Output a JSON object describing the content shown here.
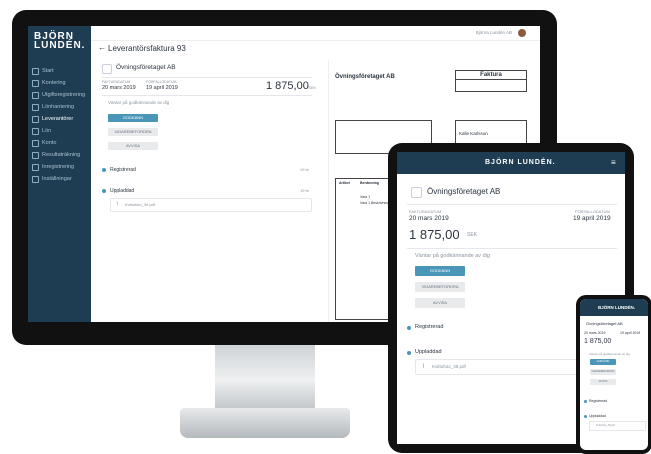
{
  "brand": {
    "line1": "BJÖRN",
    "line2": "LUNDÉN."
  },
  "sidebar": {
    "items": [
      "Start",
      "Kontering",
      "Utgiftsregistrering",
      "Lönhantering",
      "Leverantörer",
      "Lön",
      "Konto",
      "Resultaträkning",
      "Inregistrering",
      "Inställningar"
    ]
  },
  "topbar": {
    "user": "Björna Lundén AB"
  },
  "page": {
    "title": "Leverantörsfaktura 93"
  },
  "supplier": {
    "name": "Övningsföretaget AB"
  },
  "dates": {
    "invoice_label": "FAKTURADATUM",
    "invoice_date": "20 mars 2019",
    "due_label": "FÖRFALLODATUM",
    "due_date": "19 april 2019"
  },
  "amount": {
    "value": "1 875,00",
    "currency": "SEK"
  },
  "status": {
    "text": "Väntar på godkännande av dig"
  },
  "buttons": {
    "approve": "GODKÄNN",
    "forward": "VIDAREBEFORDRA",
    "reject": "AVVISA"
  },
  "timeline": {
    "registered": "Registrerad",
    "registered_date": "19 fe",
    "uploaded": "Uppladdad",
    "uploaded_date": "19 fe",
    "attachment": "Kvittofoto_39.pdf"
  },
  "invoice_doc": {
    "company": "Övningsföretaget AB",
    "header": "Faktura",
    "recipient": "Kalle Karlsson",
    "col_article": "Artikel",
    "col_desc": "Benämning",
    "row1": "Vara 1",
    "row2": "Vara 1 Beskrivning"
  }
}
